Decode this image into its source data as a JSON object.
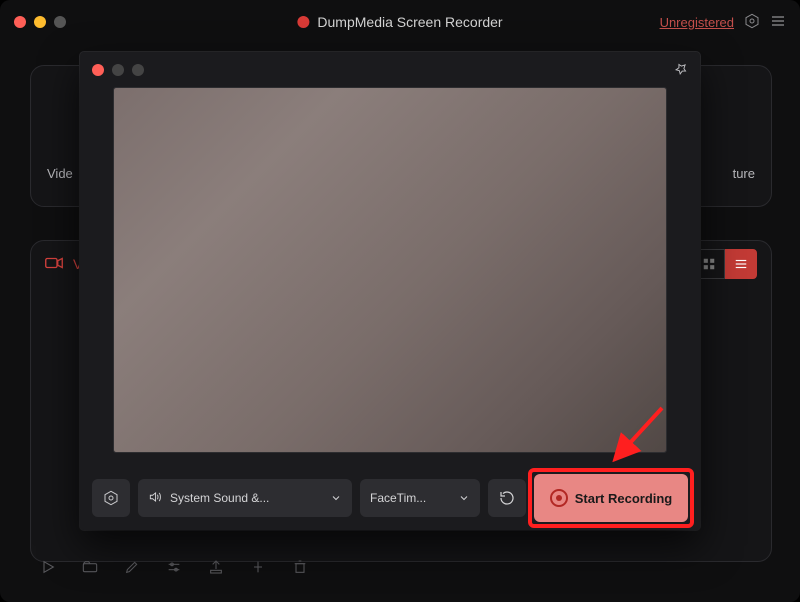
{
  "app": {
    "title": "DumpMedia Screen Recorder",
    "registration": "Unregistered"
  },
  "background": {
    "card_left_label": "Vide",
    "card_right_label": "ture",
    "list": {
      "section_label": "V",
      "view_mode": "list"
    }
  },
  "overlay": {
    "settings_label": "",
    "audio": {
      "label": "System Sound &..."
    },
    "camera": {
      "label": "FaceTim..."
    },
    "start_label": "Start Recording"
  }
}
